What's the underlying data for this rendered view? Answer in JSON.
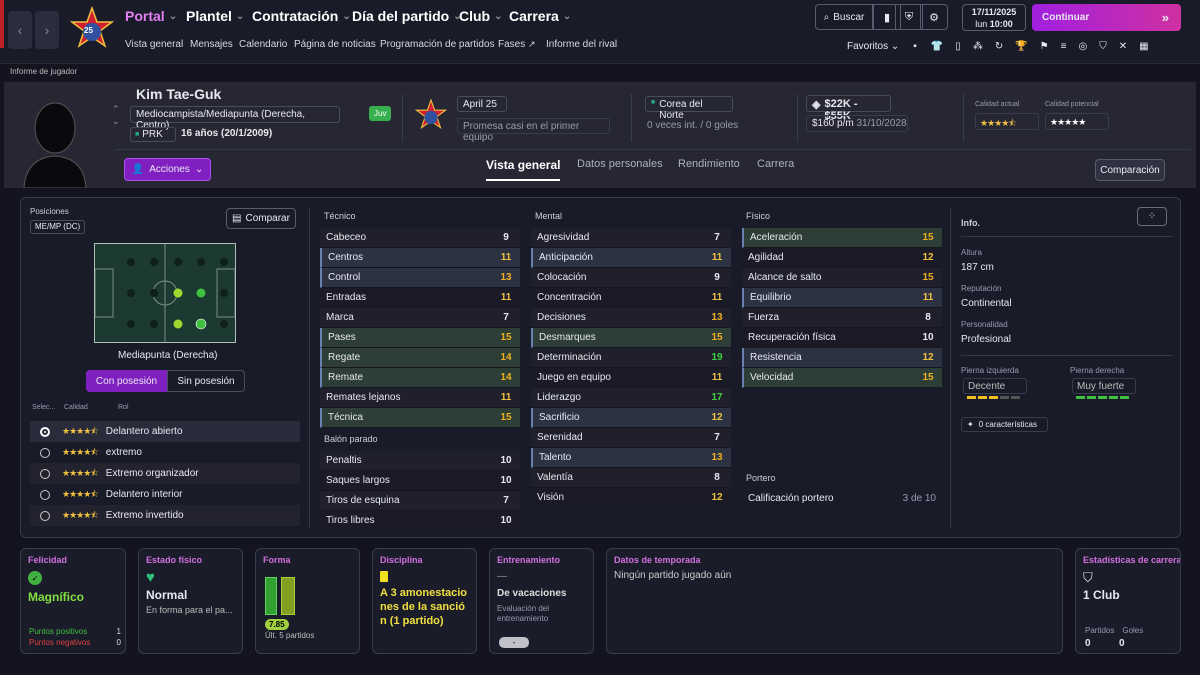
{
  "nav": {
    "menu": [
      {
        "label": "Portal",
        "accent": true
      },
      {
        "label": "Plantel"
      },
      {
        "label": "Contratación"
      },
      {
        "label": "Día del partido"
      },
      {
        "label": "Club"
      },
      {
        "label": "Carrera"
      }
    ],
    "submenu": [
      "Vista general",
      "Mensajes",
      "Calendario",
      "Página de noticias",
      "Programación de partidos",
      "Fases",
      "Informe del rival"
    ],
    "search_label": "Buscar",
    "date": "17/11/2025",
    "day": "lun",
    "time": "10:00",
    "continue_label": "Continuar",
    "favorites_label": "Favoritos",
    "club_badge": "25"
  },
  "breadcrumb": "Informe de jugador",
  "player": {
    "name": "Kim Tae-Guk",
    "position": "Mediocampista/Mediapunta (Derecha, Centro)",
    "nationality_code": "PRK",
    "age": "16 años (20/1/2009)",
    "squad_badge": "Juv",
    "club_team": "April 25",
    "club_status": "Promesa casi en el primer equipo",
    "nation": "Corea del Norte",
    "caps": "0 veces int. / 0 goles",
    "value": "$22K - $55K",
    "wage": "$160 p/m",
    "contract": "31/10/2028",
    "current_ability_label": "Calidad actual",
    "potential_ability_label": "Calidad potencial",
    "current_ability_stars": 4.5,
    "potential_ability_stars": 5,
    "actions_label": "Acciones"
  },
  "tabs": [
    "Vista general",
    "Datos personales",
    "Rendimiento",
    "Carrera"
  ],
  "compare_label": "Comparación",
  "positions": {
    "title": "Posiciones",
    "badge": "ME/MP (DC)",
    "compare": "Comparar",
    "field_label": "Mediapunta (Derecha)",
    "toggle": [
      "Con posesión",
      "Sin posesión"
    ],
    "role_headers": [
      "Selec...",
      "Calidad",
      "Rol"
    ],
    "roles": [
      {
        "name": "Delantero abierto",
        "selected": true
      },
      {
        "name": "extremo"
      },
      {
        "name": "Extremo organizador"
      },
      {
        "name": "Delantero interior"
      },
      {
        "name": "Extremo invertido"
      }
    ]
  },
  "tecnico": {
    "title": "Técnico",
    "rows": [
      [
        "Cabeceo",
        "9"
      ],
      [
        "Centros",
        "11"
      ],
      [
        "Control",
        "13"
      ],
      [
        "Entradas",
        "11"
      ],
      [
        "Marca",
        "7"
      ],
      [
        "Pases",
        "15"
      ],
      [
        "Regate",
        "14"
      ],
      [
        "Remate",
        "14"
      ],
      [
        "Remates lejanos",
        "11"
      ],
      [
        "Técnica",
        "15"
      ]
    ]
  },
  "balon": {
    "title": "Balón parado",
    "rows": [
      [
        "Penaltis",
        "10"
      ],
      [
        "Saques largos",
        "10"
      ],
      [
        "Tiros de esquina",
        "7"
      ],
      [
        "Tiros libres",
        "10"
      ]
    ]
  },
  "mental": {
    "title": "Mental",
    "rows": [
      [
        "Agresividad",
        "7"
      ],
      [
        "Anticipación",
        "11"
      ],
      [
        "Colocación",
        "9"
      ],
      [
        "Concentración",
        "11"
      ],
      [
        "Decisiones",
        "13"
      ],
      [
        "Desmarques",
        "15"
      ],
      [
        "Determinación",
        "19"
      ],
      [
        "Juego en equipo",
        "11"
      ],
      [
        "Liderazgo",
        "17"
      ],
      [
        "Sacrificio",
        "12"
      ],
      [
        "Serenidad",
        "7"
      ],
      [
        "Talento",
        "13"
      ],
      [
        "Valentía",
        "8"
      ],
      [
        "Visión",
        "12"
      ]
    ]
  },
  "fisico": {
    "title": "Físico",
    "rows": [
      [
        "Aceleración",
        "15"
      ],
      [
        "Agilidad",
        "12"
      ],
      [
        "Alcance de salto",
        "15"
      ],
      [
        "Equilibrio",
        "11"
      ],
      [
        "Fuerza",
        "8"
      ],
      [
        "Recuperación física",
        "10"
      ],
      [
        "Resistencia",
        "12"
      ],
      [
        "Velocidad",
        "15"
      ]
    ]
  },
  "portero": {
    "title": "Portero",
    "label": "Calificación portero",
    "value": "3 de 10"
  },
  "info": {
    "title": "Info.",
    "height_label": "Altura",
    "height": "187 cm",
    "rep_label": "Reputación",
    "rep": "Continental",
    "pers_label": "Personalidad",
    "pers": "Profesional",
    "left_label": "Pierna izquierda",
    "left": "Decente",
    "right_label": "Pierna derecha",
    "right": "Muy fuerte",
    "traits": "0 características"
  },
  "cards": {
    "felicidad": {
      "title": "Felicidad",
      "value": "Magnífico",
      "pos": "Puntos positivos",
      "pos_v": "1",
      "neg": "Puntos negativos",
      "neg_v": "0"
    },
    "fisico": {
      "title": "Estado físico",
      "value": "Normal",
      "sub": "En forma para el pa..."
    },
    "forma": {
      "title": "Forma",
      "value": "7.85",
      "sub": "Últ. 5 partidos"
    },
    "disciplina": {
      "title": "Disciplina",
      "value": "A 3 amonestaciones de la sanción (1 partido)"
    },
    "entrenamiento": {
      "title": "Entrenamiento",
      "dash": "—",
      "value": "De vacaciones",
      "sub": "Evaluación del entrenamiento",
      "badge": "-"
    },
    "temporada": {
      "title": "Datos de temporada",
      "value": "Ningún partido jugado aún"
    },
    "carrera": {
      "title": "Estadísticas de carrera",
      "value": "1 Club",
      "l1": "Partidos",
      "l2": "Goles",
      "v1": "0",
      "v2": "0"
    }
  }
}
